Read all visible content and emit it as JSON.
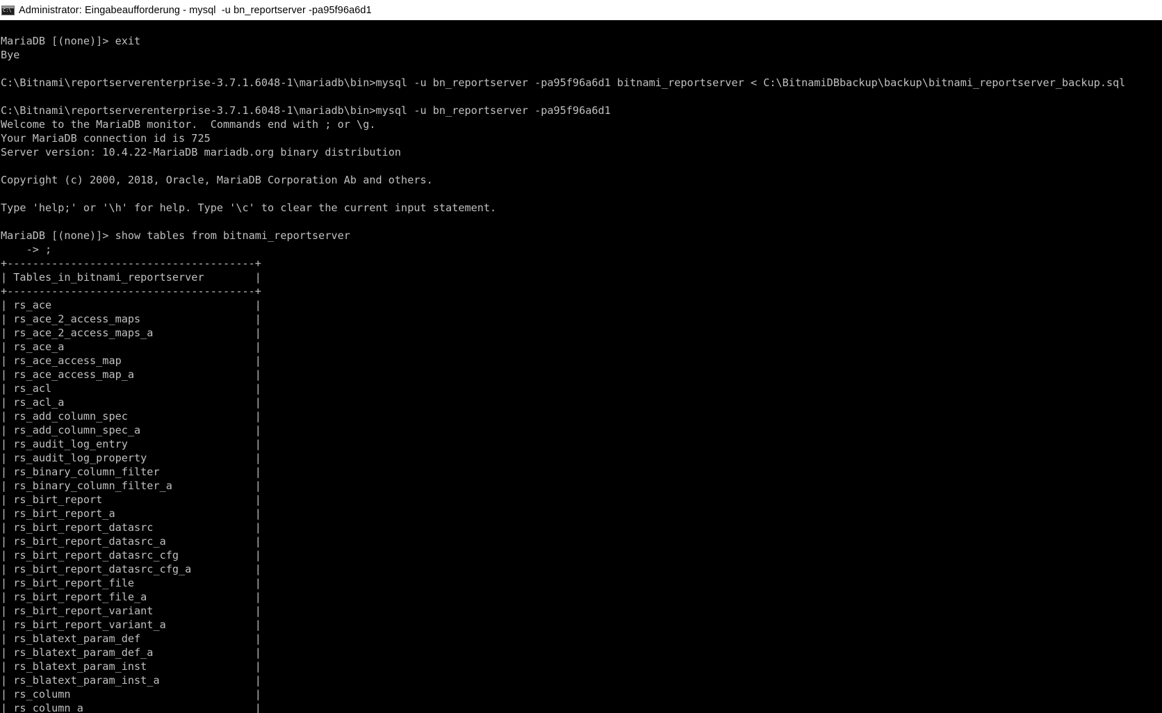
{
  "window": {
    "title": "Administrator: Eingabeaufforderung - mysql  -u bn_reportserver -pa95f96a6d1"
  },
  "colors": {
    "console_background": "#000000",
    "console_text": "#c0c0c0",
    "titlebar_background": "#ffffff"
  },
  "console": {
    "lines": [
      "MariaDB [(none)]> exit",
      "Bye",
      "",
      "C:\\Bitnami\\reportserverenterprise-3.7.1.6048-1\\mariadb\\bin>mysql -u bn_reportserver -pa95f96a6d1 bitnami_reportserver < C:\\BitnamiDBbackup\\backup\\bitnami_reportserver_backup.sql",
      "",
      "C:\\Bitnami\\reportserverenterprise-3.7.1.6048-1\\mariadb\\bin>mysql -u bn_reportserver -pa95f96a6d1",
      "Welcome to the MariaDB monitor.  Commands end with ; or \\g.",
      "Your MariaDB connection id is 725",
      "Server version: 10.4.22-MariaDB mariadb.org binary distribution",
      "",
      "Copyright (c) 2000, 2018, Oracle, MariaDB Corporation Ab and others.",
      "",
      "Type 'help;' or '\\h' for help. Type '\\c' to clear the current input statement.",
      "",
      "MariaDB [(none)]> show tables from bitnami_reportserver",
      "    -> ;",
      "+---------------------------------------+",
      "| Tables_in_bitnami_reportserver        |",
      "+---------------------------------------+",
      "| rs_ace                                |",
      "| rs_ace_2_access_maps                  |",
      "| rs_ace_2_access_maps_a                |",
      "| rs_ace_a                              |",
      "| rs_ace_access_map                     |",
      "| rs_ace_access_map_a                   |",
      "| rs_acl                                |",
      "| rs_acl_a                              |",
      "| rs_add_column_spec                    |",
      "| rs_add_column_spec_a                  |",
      "| rs_audit_log_entry                    |",
      "| rs_audit_log_property                 |",
      "| rs_binary_column_filter               |",
      "| rs_binary_column_filter_a             |",
      "| rs_birt_report                        |",
      "| rs_birt_report_a                      |",
      "| rs_birt_report_datasrc                |",
      "| rs_birt_report_datasrc_a              |",
      "| rs_birt_report_datasrc_cfg            |",
      "| rs_birt_report_datasrc_cfg_a          |",
      "| rs_birt_report_file                   |",
      "| rs_birt_report_file_a                 |",
      "| rs_birt_report_variant                |",
      "| rs_birt_report_variant_a              |",
      "| rs_blatext_param_def                  |",
      "| rs_blatext_param_def_a                |",
      "| rs_blatext_param_inst                 |",
      "| rs_blatext_param_inst_a               |",
      "| rs_column                             |",
      "| rs_column_a                           |"
    ]
  }
}
